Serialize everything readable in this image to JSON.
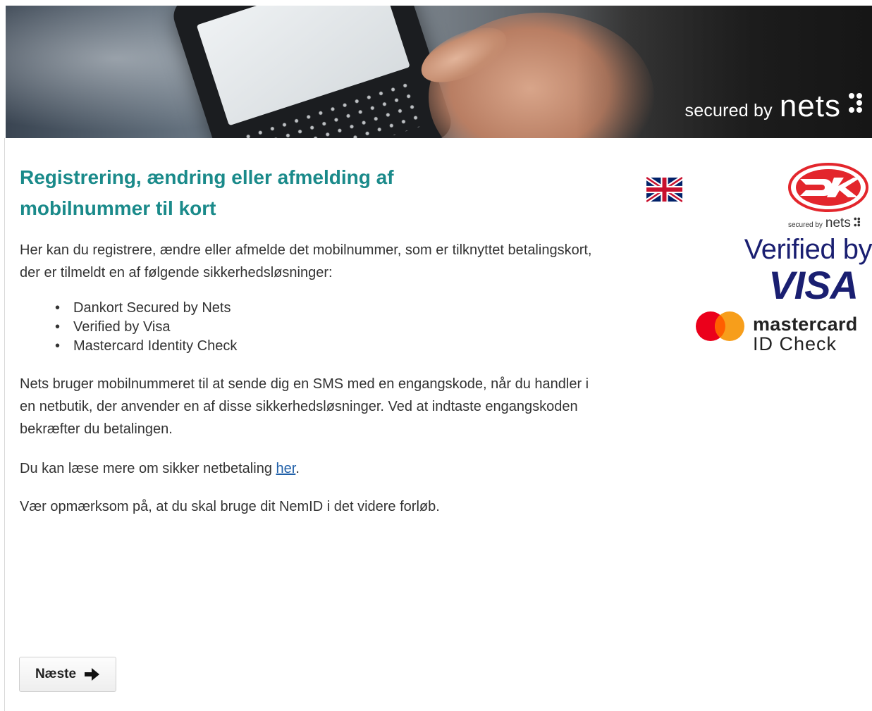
{
  "header": {
    "secured_small": "secured by",
    "secured_brand": "nets"
  },
  "content": {
    "title": "Registrering, ændring eller afmelding af mobilnummer til kort",
    "intro": "Her kan du registrere, ændre eller afmelde det mobilnummer, som er tilknyttet betalingskort, der er tilmeldt en af følgende sikkerhedsløsninger:",
    "bullets": [
      "Dankort Secured by Nets",
      "Verified by Visa",
      "Mastercard Identity Check"
    ],
    "explain": "Nets bruger mobilnummeret til at sende dig en SMS med en engangskode, når du handler i en netbutik, der anvender en af disse sikkerhedsløsninger. Ved at indtaste engangskoden bekræfter du betalingen.",
    "read_more_prefix": "Du kan læse mere om sikker netbetaling ",
    "read_more_link": "her",
    "read_more_suffix": ".",
    "notice": "Vær opmærksom på, at du skal bruge dit NemID i det videre forløb."
  },
  "logos": {
    "dankort_secured_small": "secured by",
    "dankort_secured_brand": "nets",
    "visa_line1": "Verified by",
    "visa_line2": "VISA",
    "mastercard_line1": "mastercard",
    "mastercard_line2": "ID Check"
  },
  "icons": {
    "language": "uk-flag-icon",
    "next": "arrow-right-icon"
  },
  "colors": {
    "title": "#1a8a8a",
    "link": "#1f5fa8",
    "dankort_red": "#e3262c",
    "visa_blue": "#1a1f71",
    "mc_red": "#eb001b",
    "mc_orange": "#f79e1b"
  },
  "actions": {
    "next_label": "Næste"
  }
}
